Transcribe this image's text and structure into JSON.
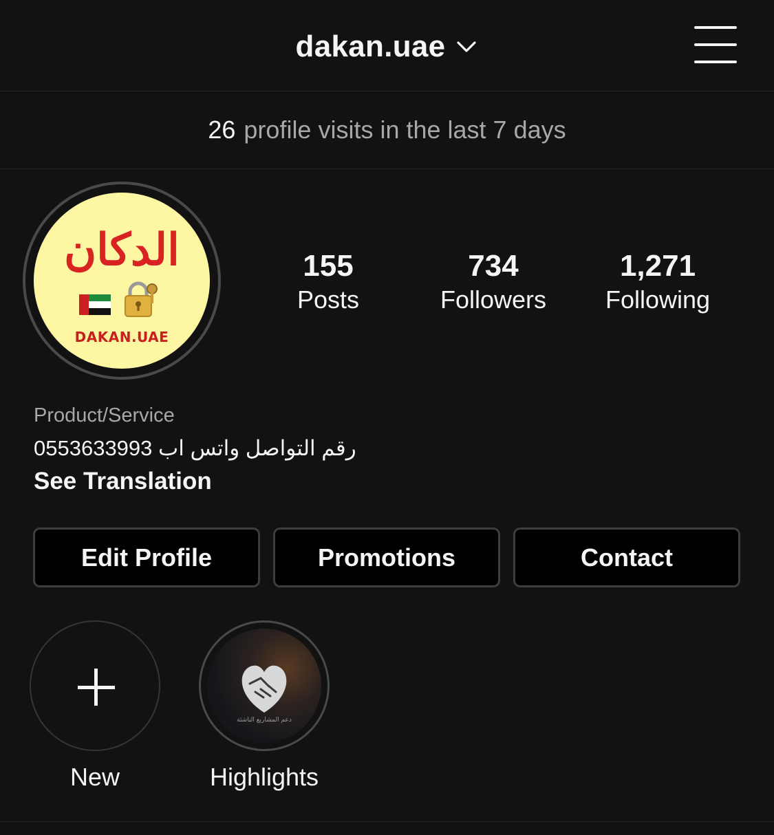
{
  "header": {
    "username": "dakan.uae",
    "chevron_icon": "chevron-down-icon",
    "menu_icon": "hamburger-menu-icon"
  },
  "visits": {
    "count": "26",
    "text": "profile visits in the last 7 days"
  },
  "profile": {
    "avatar": {
      "logo_arabic": "الدكان",
      "logo_english": "DAKAN.UAE",
      "flag_icon": "uae-flag-icon",
      "lock_icon": "lock-key-icon",
      "background_color": "#fdf6a3"
    },
    "stats": [
      {
        "count": "155",
        "label": "Posts"
      },
      {
        "count": "734",
        "label": "Followers"
      },
      {
        "count": "1,271",
        "label": "Following"
      }
    ],
    "category": "Product/Service",
    "bio": "رقم التواصل واتس اب 0553633993",
    "see_translation": "See Translation"
  },
  "buttons": {
    "edit_profile": "Edit Profile",
    "promotions": "Promotions",
    "contact": "Contact"
  },
  "highlights": [
    {
      "label": "New",
      "icon": "plus-icon"
    },
    {
      "label": "Highlights",
      "icon": "heart-handshake-icon",
      "caption": "دعم المشاريع الناشئة"
    }
  ],
  "colors": {
    "background": "#121212",
    "text_primary": "#f5f5f5",
    "text_secondary": "#a8a8a8",
    "logo_red": "#d92222"
  }
}
